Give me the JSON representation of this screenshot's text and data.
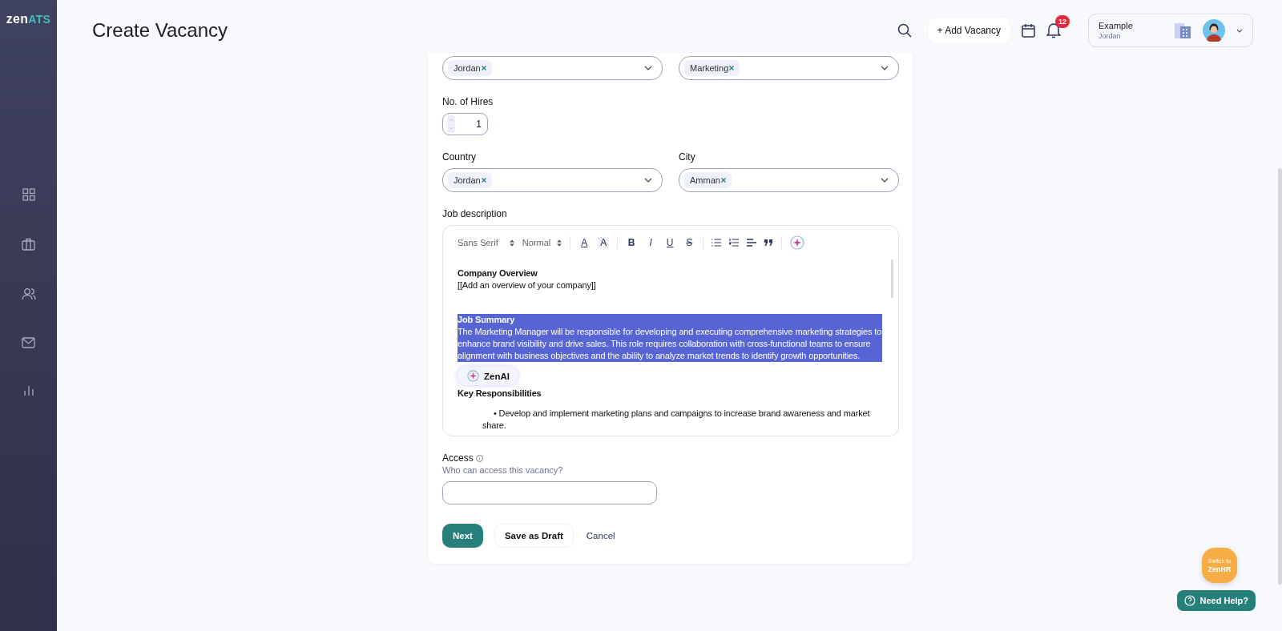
{
  "sidebar": {
    "logo_main": "zen",
    "logo_accent": "ATS"
  },
  "header": {
    "title": "Create Vacancy",
    "add_button": "+ Add Vacancy",
    "notifications": "12",
    "account": {
      "name": "Example",
      "location": "Jordan"
    }
  },
  "form": {
    "top_row": [
      {
        "tags": [
          "Jordan"
        ]
      },
      {
        "tags": [
          "Marketing"
        ]
      }
    ],
    "hires": {
      "label": "No. of Hires",
      "value": "1"
    },
    "location_row": [
      {
        "label": "Country",
        "tags": [
          "Jordan"
        ]
      },
      {
        "label": "City",
        "tags": [
          "Amman"
        ]
      }
    ],
    "job_description": {
      "label": "Job description",
      "font": "Sans Serif",
      "size": "Normal",
      "format_buttons": [
        {
          "kind": "color",
          "glyph": "A"
        },
        {
          "kind": "highlight",
          "glyph": "A"
        },
        {
          "kind": "bold",
          "glyph": "B"
        },
        {
          "kind": "italic",
          "glyph": "I"
        },
        {
          "kind": "underline",
          "glyph": "U"
        },
        {
          "kind": "strike",
          "glyph": "S"
        }
      ],
      "blocks": [
        {
          "kind": "heading",
          "text": "Company Overview",
          "selected": false
        },
        {
          "kind": "paragraph",
          "text": "[[Add an overview of your company]]",
          "selected": false
        },
        {
          "kind": "blank"
        },
        {
          "kind": "heading",
          "text": "Job Summary",
          "selected": true
        },
        {
          "kind": "paragraph",
          "text": "The Marketing Manager will be responsible for developing and executing comprehensive marketing strategies to enhance brand visibility and drive sales. This role requires collaboration with cross-functional teams to ensure alignment with business objectives and the ability to analyze market trends to identify growth opportunities.",
          "selected": true
        },
        {
          "kind": "popup",
          "text": "ZenAI"
        },
        {
          "kind": "heading",
          "text": "Key Responsibilities",
          "selected": false
        },
        {
          "kind": "bullet",
          "text": "• Develop and implement marketing plans and campaigns to increase brand awareness and market share.",
          "selected": false
        }
      ]
    },
    "access": {
      "label": "Access",
      "hint": "Who can access this vacancy?"
    },
    "buttons": [
      {
        "kind": "primary",
        "label": "Next"
      },
      {
        "kind": "secondary",
        "label": "Save as Draft"
      },
      {
        "kind": "link",
        "label": "Cancel"
      }
    ]
  },
  "switch": {
    "line1": "Switch to",
    "line2": "ZenHR"
  },
  "help": "Need Help?"
}
